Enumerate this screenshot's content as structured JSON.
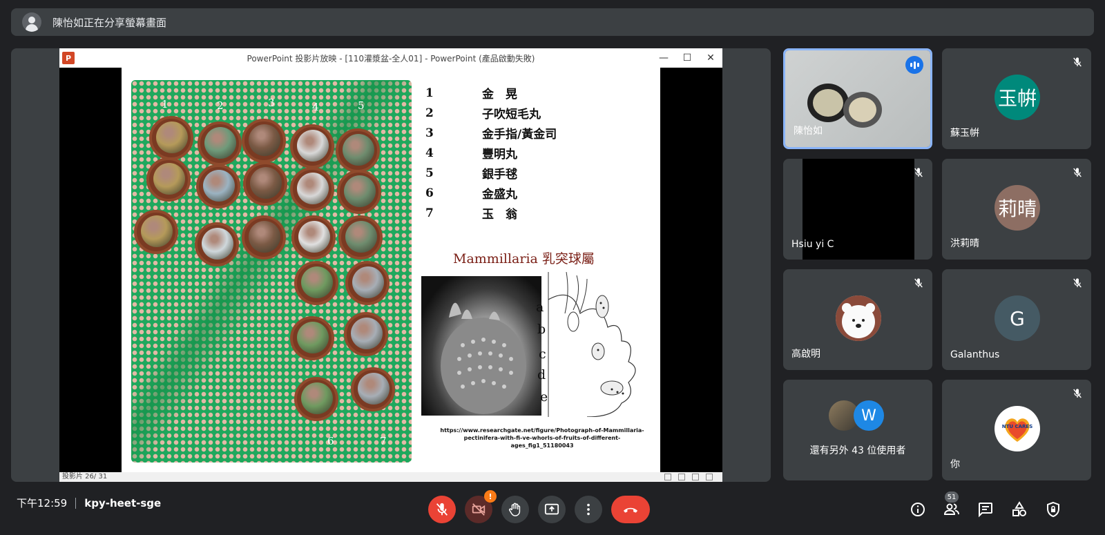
{
  "banner": {
    "text": "陳怡如正在分享螢幕畫面"
  },
  "ppt": {
    "title": "PowerPoint 投影片放映 - [110灌漿盆-全人01] - PowerPoint (產品啟動失敗)",
    "status": "投影片 26/ 31"
  },
  "slide": {
    "basket_numbers": [
      "1",
      "2",
      "3",
      "4",
      "5",
      "6",
      "7"
    ],
    "items": [
      {
        "num": "1",
        "name": "金　晃"
      },
      {
        "num": "2",
        "name": "子吹短毛丸"
      },
      {
        "num": "3",
        "name": "金手指/黃金司"
      },
      {
        "num": "4",
        "name": "豐明丸"
      },
      {
        "num": "5",
        "name": "銀手毬"
      },
      {
        "num": "6",
        "name": "金盛丸"
      },
      {
        "num": "7",
        "name": "玉　翁"
      }
    ],
    "genus": "Mammillaria 乳突球屬",
    "callouts": [
      "a",
      "b",
      "c",
      "d",
      "e"
    ],
    "reference": "https://www.researchgate.net/figure/Photograph-of-Mammillaria-pectinifera-with-fi-ve-whorls-of-fruits-of-different-ages_fig1_51180043"
  },
  "participants": [
    {
      "name": "陳怡如",
      "kind": "video",
      "speaking": true
    },
    {
      "name": "蘇玉帲",
      "initials": "玉帲",
      "color": "#00897b",
      "muted": true
    },
    {
      "name": "Hsiu yi C",
      "kind": "video-black",
      "muted": true
    },
    {
      "name": "洪莉晴",
      "initials": "莉晴",
      "color": "#8d6e63",
      "muted": true
    },
    {
      "name": "高啟明",
      "kind": "bear",
      "muted": true
    },
    {
      "name": "Galanthus",
      "initials": "G",
      "color": "#455a64",
      "muted": true
    },
    {
      "name": "還有另外 43 位使用者",
      "kind": "others",
      "initials": "W"
    },
    {
      "name": "你",
      "kind": "ntu",
      "muted": true,
      "logo_text": "NTU CARES"
    }
  ],
  "bottom": {
    "time": "下午12:59",
    "meeting_code": "kpy-heet-sge",
    "camera_warning": "!",
    "people_count": "51"
  },
  "colors": {
    "background": "#202124",
    "tile": "#3c4043",
    "red": "#ea4335",
    "accent": "#1a73e8"
  }
}
